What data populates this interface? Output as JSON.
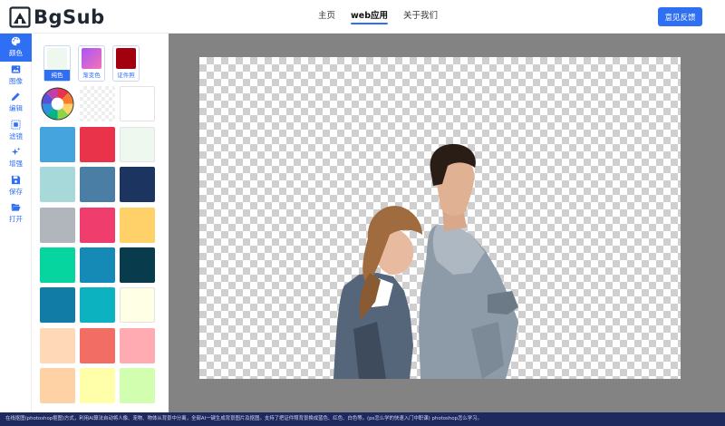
{
  "header": {
    "logo_text": "BgSub",
    "nav": [
      "主页",
      "web应用",
      "关于我们"
    ],
    "feedback_label": "意见反馈"
  },
  "sidebar": {
    "items": [
      {
        "label": "颜色",
        "icon": "palette-icon"
      },
      {
        "label": "图像",
        "icon": "image-icon"
      },
      {
        "label": "编辑",
        "icon": "pencil-icon"
      },
      {
        "label": "滤镜",
        "icon": "filter-icon"
      },
      {
        "label": "增强",
        "icon": "sparkle-icon"
      },
      {
        "label": "保存",
        "icon": "save-icon"
      },
      {
        "label": "打开",
        "icon": "folder-open-icon"
      }
    ]
  },
  "panel": {
    "tabs": [
      {
        "label": "纯色",
        "color": "#eef8ee"
      },
      {
        "label": "渐变色",
        "color": "#c35cd8"
      },
      {
        "label": "证件照",
        "color": "#a3000f"
      }
    ],
    "swatches": [
      "color-wheel",
      "transparent",
      "#ffffff",
      "#45a4dd",
      "#e8334a",
      "#eef8ee",
      "#a7d9db",
      "#4a7ea4",
      "#1c3560",
      "#b1b6bc",
      "#ef3d6e",
      "#ffd168",
      "#06d5a0",
      "#168ab7",
      "#083b4c",
      "#117da7",
      "#0db2c0",
      "#ffffe6",
      "#ffd9b7",
      "#f26d63",
      "#ffabb1",
      "#ffd2a6",
      "#ffffa9",
      "#d2ffaf"
    ]
  },
  "statusbar": {
    "text": "在线抠图(photoshop抠图)方式，利用AI算法自动将人像、宠物、物体从背景中分离，全部AI一键生成背景图片及抠图。支持了把证件照背景换成蓝色、红色、白色等。(ps怎么学的快速入门中职课) photoshop怎么学习。"
  }
}
